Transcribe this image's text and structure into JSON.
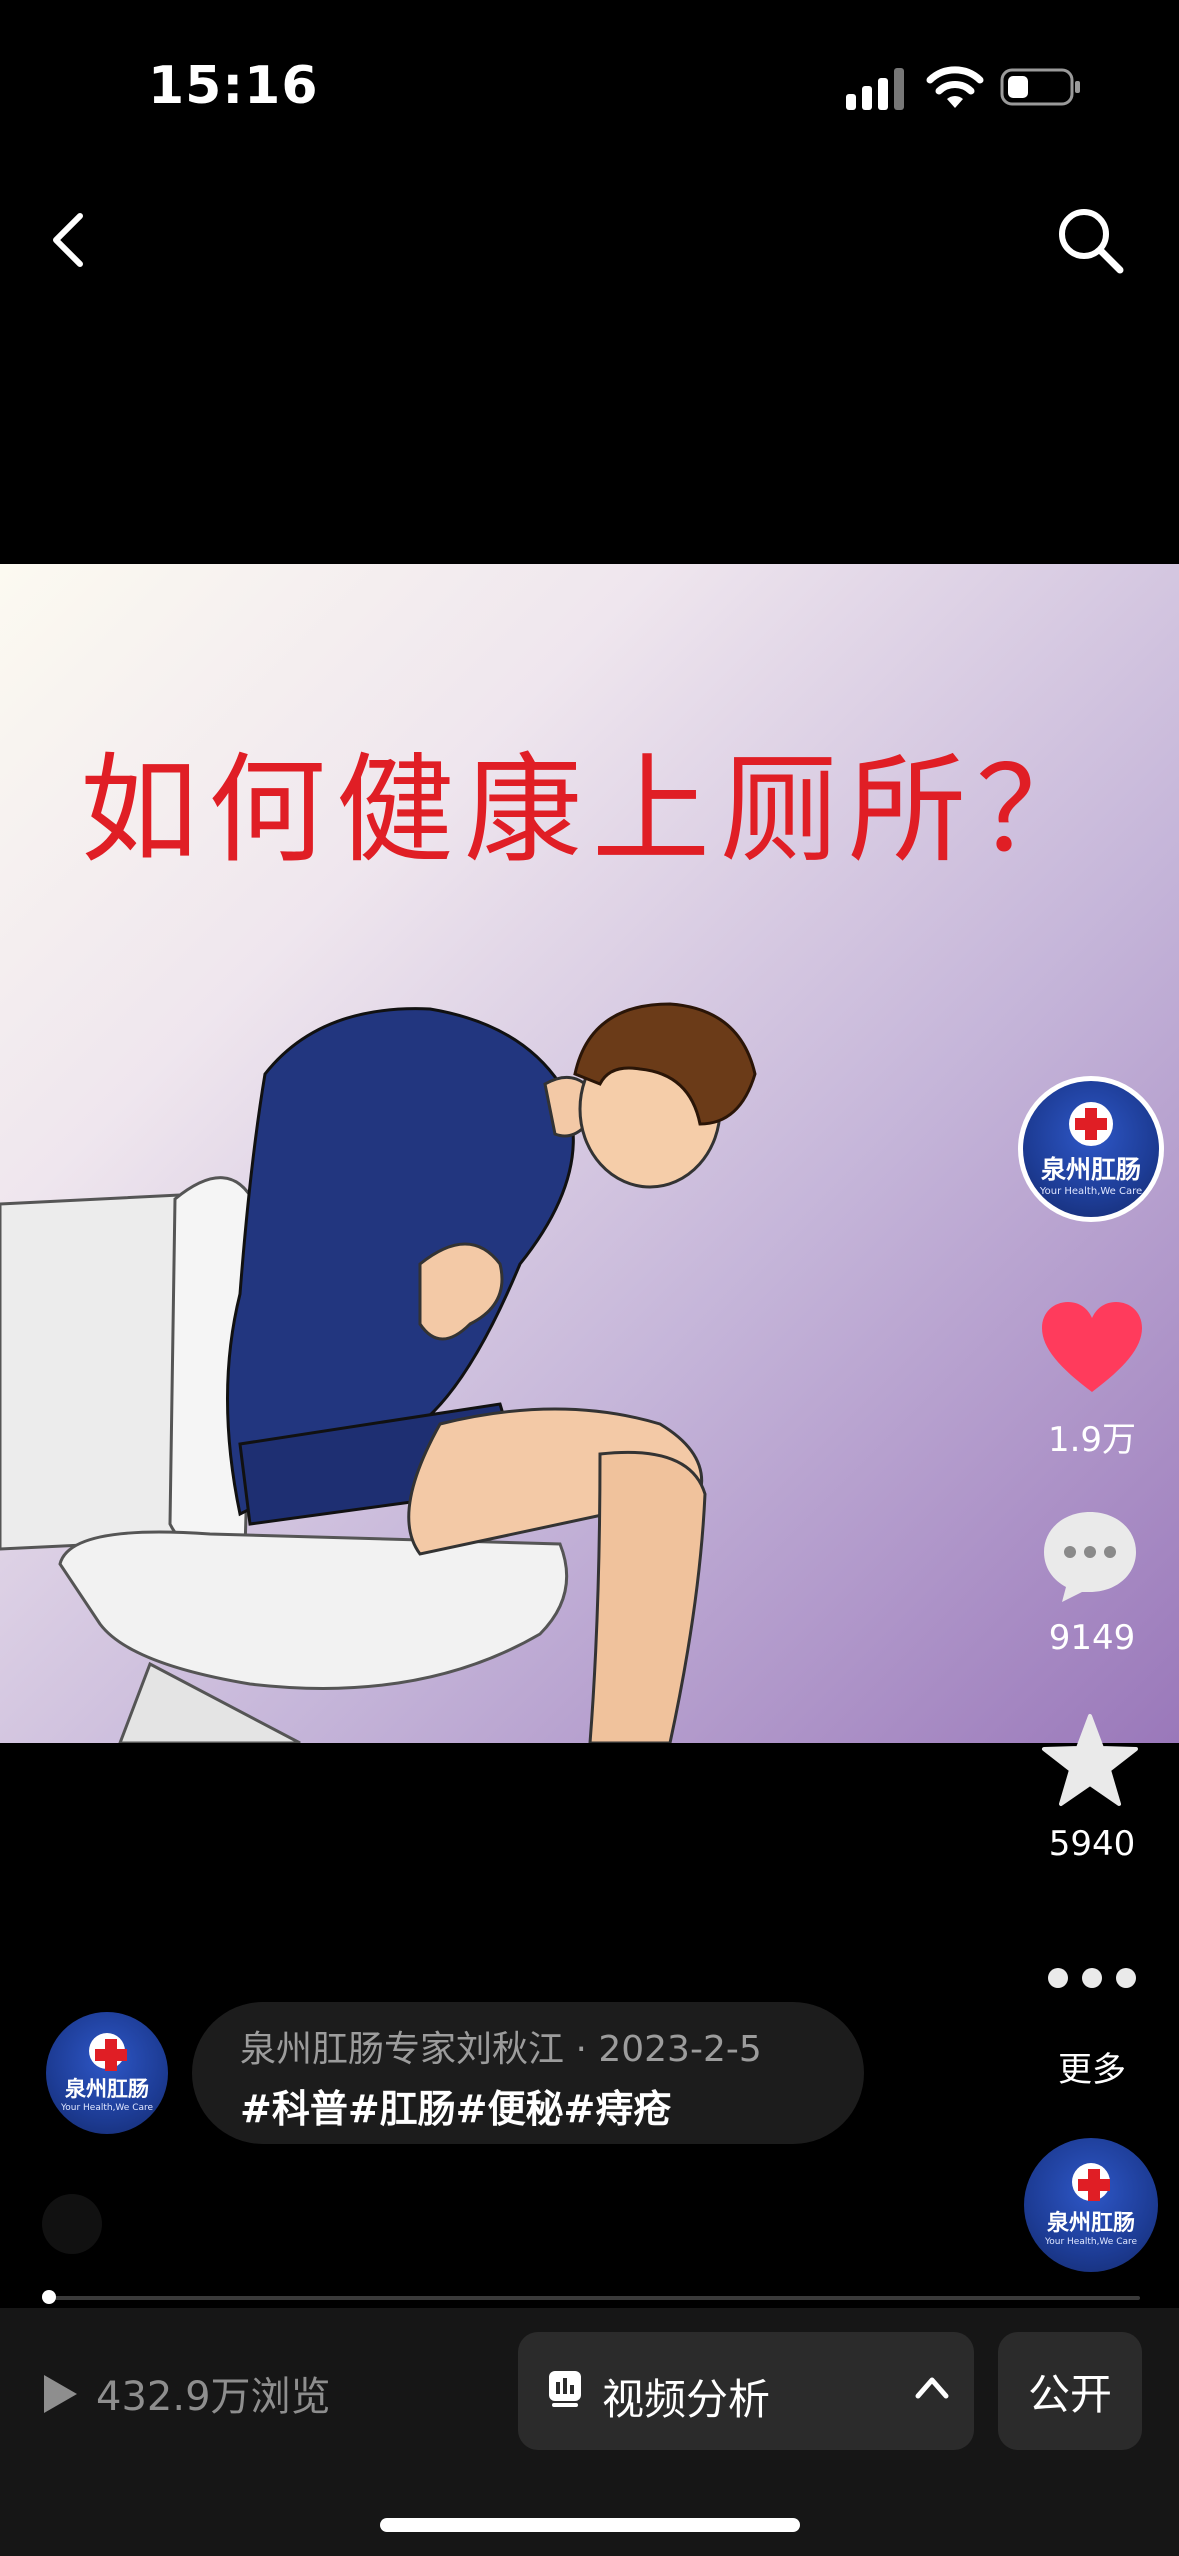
{
  "status_bar": {
    "time": "15:16"
  },
  "video": {
    "overlay_title": "如何健康上厕所？"
  },
  "creator": {
    "avatar_name": "泉州肛肠",
    "avatar_tagline": "Your Health,We Care"
  },
  "actions": {
    "likes": "1.9万",
    "comments": "9149",
    "favorites": "5940",
    "more_label": "更多"
  },
  "caption": {
    "author_date": "泉州肛肠专家刘秋江 · 2023-2-5",
    "hashtags": "#科普#肛肠#便秘#痔疮"
  },
  "playback": {
    "progress": 0.005
  },
  "bottom_bar": {
    "views": "432.9万浏览",
    "analysis_label": "视频分析",
    "visibility_label": "公开"
  },
  "colors": {
    "like_red": "#ff3b5c",
    "title_red": "#e01e25",
    "brand_blue": "#1d3c95"
  }
}
